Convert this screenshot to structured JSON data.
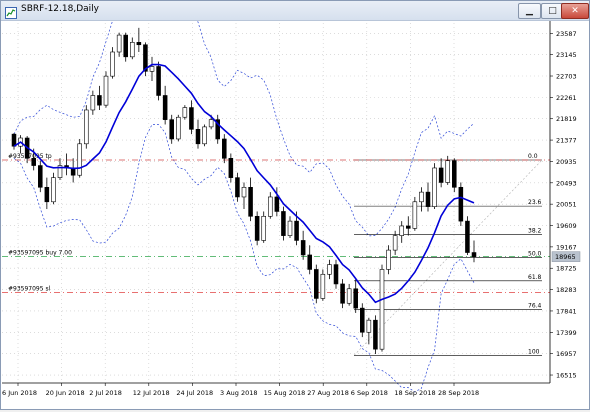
{
  "window": {
    "title": "SBRF-12.18,Daily",
    "buttons": {
      "minimize": "▁",
      "maximize": "□",
      "close": "✕"
    }
  },
  "colors": {
    "ma": "#0000d8",
    "bands": "#2b46d6",
    "tp_line": "#d24a4a",
    "sl_line": "#e04040",
    "buy_line": "#2ea64b",
    "fib": "#000000",
    "candle": "#000000"
  },
  "chart_data": {
    "type": "candlestick",
    "symbol": "SBRF-12.18",
    "timeframe": "Daily",
    "y_ticks": [
      23587,
      23145,
      22703,
      22261,
      21819,
      21377,
      20935,
      20493,
      20051,
      19609,
      19167,
      18725,
      18283,
      17841,
      17399,
      16957,
      16515
    ],
    "x_ticks": [
      "6 Jun 2018",
      "20 Jun 2018",
      "2 Jul 2018",
      "12 Jul 2018",
      "24 Jul 2018",
      "3 Aug 2018",
      "15 Aug 2018",
      "27 Aug 2018",
      "6 Sep 2018",
      "18 Sep 2018",
      "28 Sep 2018"
    ],
    "ylim": [
      16350,
      23800
    ],
    "current_price": "18965",
    "order_labels": {
      "tp": "#93597095 tp",
      "buy": "#93597095 buy 7.00",
      "sl": "#93597095 sl"
    },
    "order_levels": {
      "tp": 20965,
      "buy": 18965,
      "sl": 18220
    },
    "fibonacci": {
      "high": 20965,
      "low": 16920,
      "levels": [
        {
          "label": "0.0",
          "ratio": 0.0
        },
        {
          "label": "23.6",
          "ratio": 0.236
        },
        {
          "label": "38.2",
          "ratio": 0.382
        },
        {
          "label": "50.0",
          "ratio": 0.5
        },
        {
          "label": "61.8",
          "ratio": 0.618
        },
        {
          "label": "76.4",
          "ratio": 0.764
        },
        {
          "label": "100",
          "ratio": 1.0
        }
      ]
    },
    "candles": [
      [
        21500,
        21520,
        21180,
        21250
      ],
      [
        21250,
        21480,
        21100,
        21420
      ],
      [
        21420,
        21460,
        20900,
        21000
      ],
      [
        21000,
        21200,
        20750,
        20850
      ],
      [
        20850,
        20950,
        20300,
        20400
      ],
      [
        20400,
        20600,
        19950,
        20100
      ],
      [
        20100,
        20700,
        20050,
        20600
      ],
      [
        20600,
        21000,
        20550,
        20850
      ],
      [
        20850,
        21100,
        20650,
        20800
      ],
      [
        20800,
        21000,
        20500,
        20650
      ],
      [
        20650,
        21400,
        20600,
        21300
      ],
      [
        21300,
        22100,
        21200,
        22000
      ],
      [
        22000,
        22400,
        21900,
        22300
      ],
      [
        22300,
        22500,
        22000,
        22100
      ],
      [
        22100,
        22800,
        22050,
        22700
      ],
      [
        22700,
        23300,
        22650,
        23200
      ],
      [
        23200,
        23600,
        23100,
        23550
      ],
      [
        23550,
        23600,
        23000,
        23100
      ],
      [
        23100,
        23500,
        23050,
        23400
      ],
      [
        23400,
        23700,
        23200,
        23350
      ],
      [
        23350,
        23400,
        22700,
        22800
      ],
      [
        22800,
        23100,
        22600,
        22900
      ],
      [
        22900,
        23000,
        22200,
        22300
      ],
      [
        22300,
        22500,
        21700,
        21800
      ],
      [
        21800,
        21900,
        21300,
        21400
      ],
      [
        21400,
        21900,
        21350,
        21850
      ],
      [
        21850,
        22100,
        21800,
        22050
      ],
      [
        22050,
        22200,
        21500,
        21600
      ],
      [
        21600,
        21800,
        21200,
        21300
      ],
      [
        21300,
        21700,
        21250,
        21650
      ],
      [
        21650,
        21900,
        21600,
        21800
      ],
      [
        21800,
        21900,
        21300,
        21400
      ],
      [
        21400,
        21500,
        20900,
        21000
      ],
      [
        21000,
        21100,
        20500,
        20600
      ],
      [
        20600,
        20700,
        20100,
        20200
      ],
      [
        20200,
        20500,
        19950,
        20400
      ],
      [
        20400,
        20600,
        19700,
        19800
      ],
      [
        19800,
        19900,
        19200,
        19300
      ],
      [
        19300,
        19900,
        19250,
        19800
      ],
      [
        19800,
        20300,
        19750,
        20200
      ],
      [
        20200,
        20400,
        19800,
        19900
      ],
      [
        19900,
        20000,
        19300,
        19400
      ],
      [
        19400,
        19800,
        19350,
        19700
      ],
      [
        19700,
        19900,
        19200,
        19300
      ],
      [
        19300,
        19500,
        18900,
        19000
      ],
      [
        19000,
        19200,
        18600,
        18700
      ],
      [
        18700,
        18800,
        18000,
        18100
      ],
      [
        18100,
        18700,
        18050,
        18600
      ],
      [
        18600,
        18900,
        18500,
        18800
      ],
      [
        18800,
        18900,
        18300,
        18400
      ],
      [
        18400,
        18500,
        17900,
        18000
      ],
      [
        18000,
        18400,
        17950,
        18300
      ],
      [
        18300,
        18500,
        17800,
        17900
      ],
      [
        17900,
        18000,
        17300,
        17400
      ],
      [
        17400,
        17700,
        17150,
        17650
      ],
      [
        17650,
        17750,
        16950,
        17050
      ],
      [
        17050,
        18800,
        17000,
        18700
      ],
      [
        18700,
        19200,
        18600,
        19100
      ],
      [
        19100,
        19500,
        19000,
        19400
      ],
      [
        19400,
        19700,
        19250,
        19600
      ],
      [
        19600,
        19800,
        19400,
        19550
      ],
      [
        19550,
        20200,
        19500,
        20100
      ],
      [
        20100,
        20400,
        19900,
        20300
      ],
      [
        20300,
        20500,
        19900,
        20000
      ],
      [
        20000,
        20900,
        19950,
        20800
      ],
      [
        20800,
        21000,
        20400,
        20500
      ],
      [
        20500,
        21050,
        20450,
        20950
      ],
      [
        20950,
        21000,
        20300,
        20400
      ],
      [
        20400,
        20500,
        19600,
        19700
      ],
      [
        19700,
        19800,
        19000,
        19050
      ],
      [
        19050,
        19300,
        18850,
        18965
      ]
    ]
  }
}
